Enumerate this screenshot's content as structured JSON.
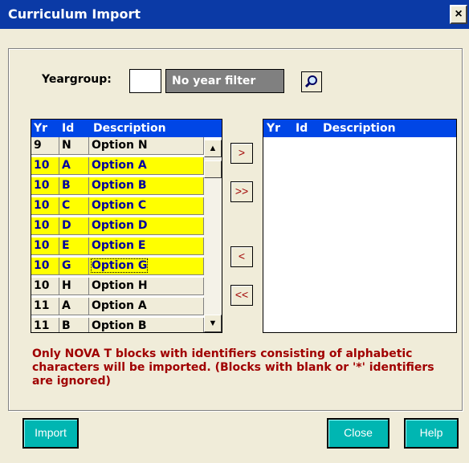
{
  "window": {
    "title": "Curriculum Import",
    "close_glyph": "×"
  },
  "yeargroup": {
    "label": "Yeargroup:",
    "value": "",
    "filter_text": "No year filter"
  },
  "source_list": {
    "headers": [
      "Yr",
      "Id",
      "Description"
    ],
    "rows": [
      {
        "yr": "9",
        "id": "N",
        "desc": "Option N",
        "style": "plain"
      },
      {
        "yr": "10",
        "id": "A",
        "desc": "Option A",
        "style": "hl"
      },
      {
        "yr": "10",
        "id": "B",
        "desc": "Option B",
        "style": "hl"
      },
      {
        "yr": "10",
        "id": "C",
        "desc": "Option C",
        "style": "hl"
      },
      {
        "yr": "10",
        "id": "D",
        "desc": "Option D",
        "style": "hl"
      },
      {
        "yr": "10",
        "id": "E",
        "desc": "Option E",
        "style": "hl"
      },
      {
        "yr": "10",
        "id": "G",
        "desc": "Option G",
        "style": "hl"
      },
      {
        "yr": "10",
        "id": "H",
        "desc": "Option H",
        "style": "plain"
      },
      {
        "yr": "11",
        "id": "A",
        "desc": "Option A",
        "style": "plain"
      },
      {
        "yr": "11",
        "id": "B",
        "desc": "Option B",
        "style": "plain"
      }
    ]
  },
  "dest_list": {
    "headers": [
      "Yr",
      "Id",
      "Description"
    ]
  },
  "move_buttons": {
    "add_one": ">",
    "add_all": ">>",
    "remove_one": "<",
    "remove_all": "<<"
  },
  "scroll": {
    "up": "▲",
    "down": "▼"
  },
  "note": "Only NOVA T blocks with identifiers consisting of alphabetic characters will be imported. (Blocks with blank or '*' identifiers are ignored)",
  "buttons": {
    "import": "Import",
    "close": "Close",
    "help": "Help"
  },
  "icons": {
    "search": "search-icon"
  },
  "colors": {
    "title_bar": "#0b3aa6",
    "list_header": "#0046e6",
    "highlight": "#ffff00",
    "note_text": "#a00000",
    "action_button": "#00b6b2"
  }
}
